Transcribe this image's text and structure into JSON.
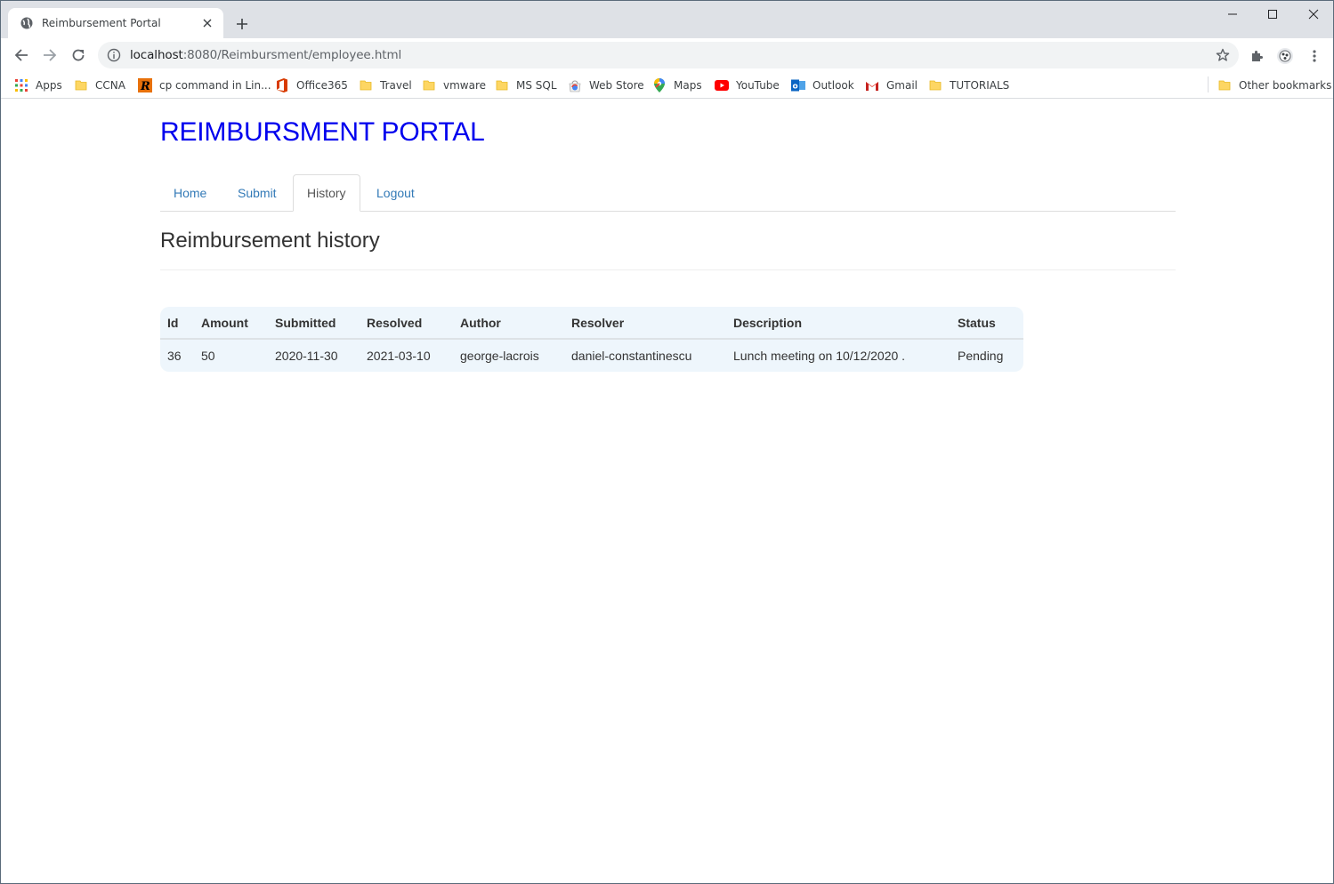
{
  "browser": {
    "tab_title": "Reimbursement Portal",
    "url_host": "localhost",
    "url_rest": ":8080/Reimbursment/employee.html",
    "bookmarks": [
      {
        "label": "Apps"
      },
      {
        "label": "CCNA"
      },
      {
        "label": "cp command in Lin..."
      },
      {
        "label": "Office365"
      },
      {
        "label": "Travel"
      },
      {
        "label": "vmware"
      },
      {
        "label": "MS SQL"
      },
      {
        "label": "Web Store"
      },
      {
        "label": "Maps"
      },
      {
        "label": "YouTube"
      },
      {
        "label": "Outlook"
      },
      {
        "label": "Gmail"
      },
      {
        "label": "TUTORIALS"
      },
      {
        "label": "Other bookmarks"
      }
    ]
  },
  "page": {
    "portal_title": "REIMBURSMENT PORTAL",
    "nav": [
      {
        "label": "Home"
      },
      {
        "label": "Submit"
      },
      {
        "label": "History"
      },
      {
        "label": "Logout"
      }
    ],
    "heading": "Reimbursement history",
    "table": {
      "headers": [
        "Id",
        "Amount",
        "Submitted",
        "Resolved",
        "Author",
        "Resolver",
        "Description",
        "Status"
      ],
      "rows": [
        [
          "36",
          "50",
          "2020-11-30",
          "2021-03-10",
          "george-lacrois",
          "daniel-constantinescu",
          "Lunch meeting on 10/12/2020 .",
          "Pending"
        ]
      ]
    }
  },
  "colors": {
    "portal_title": "#0000ee",
    "nav_link": "#337ab7",
    "table_bg": "#eef6fc"
  }
}
